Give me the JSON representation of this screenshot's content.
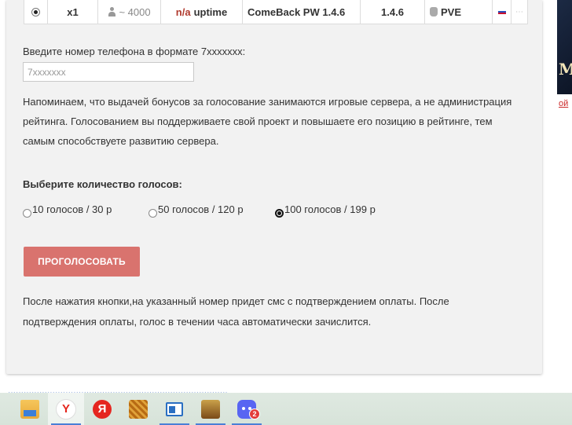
{
  "server_row": {
    "rate": "x1",
    "votes": "~ 4000",
    "uptime_na": "n/a",
    "uptime_label": "uptime",
    "name": "ComeBack PW 1.4.6",
    "version": "1.4.6",
    "type": "PVE"
  },
  "phone": {
    "label": "Введите номер телефона в формате 7xxxxxxx:",
    "placeholder": "7xxxxxxx"
  },
  "info_text": "Напоминаем, что выдачей бонусов за голосование занимаются игровые сервера, а не администрация рейтинга. Голосованием вы поддерживаете свой проект и повышаете его позицию в рейтинге, тем самым способствуете развитию сервера.",
  "votes": {
    "title": "Выберите количество голосов:",
    "options": [
      {
        "label": "10 голосов / 30 р",
        "checked": false
      },
      {
        "label": "50 голосов / 120 р",
        "checked": false
      },
      {
        "label": "100 голосов / 199 р",
        "checked": true
      }
    ]
  },
  "vote_button": "ПРОГОЛОСОВАТЬ",
  "note_text": "После нажатия кнопки,на указанный номер придет смс с подтверждением оплаты. После подтверждения оплаты, голос в течении часа автоматически зачислится.",
  "side": {
    "image_text": "M",
    "link_text": "ой"
  },
  "taskbar": {
    "discord_badge": "2"
  },
  "colors": {
    "button": "#d9736e",
    "na_red": "#b03a2e",
    "taskbar": "#dfe9e1"
  }
}
